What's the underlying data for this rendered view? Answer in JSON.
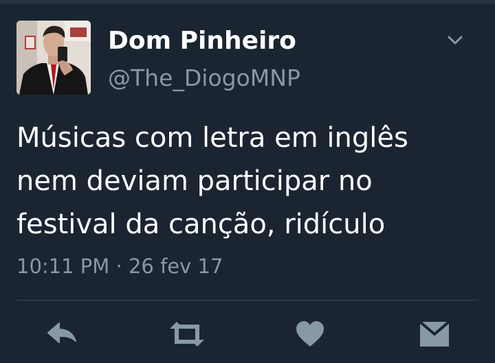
{
  "tweet": {
    "display_name": "Dom Pinheiro",
    "handle": "@The_DiogoMNP",
    "text_lines": [
      "Músicas com letra em inglês",
      "nem deviam participar no",
      "festival da canção, ridículo"
    ],
    "time": "10:11 PM",
    "separator": "·",
    "date": "26 fev 17"
  },
  "actions": {
    "reply": "reply-icon",
    "retweet": "retweet-icon",
    "like": "heart-icon",
    "message": "envelope-icon"
  },
  "colors": {
    "background": "#1b2532",
    "text": "#ffffff",
    "secondary": "#8899a6"
  }
}
